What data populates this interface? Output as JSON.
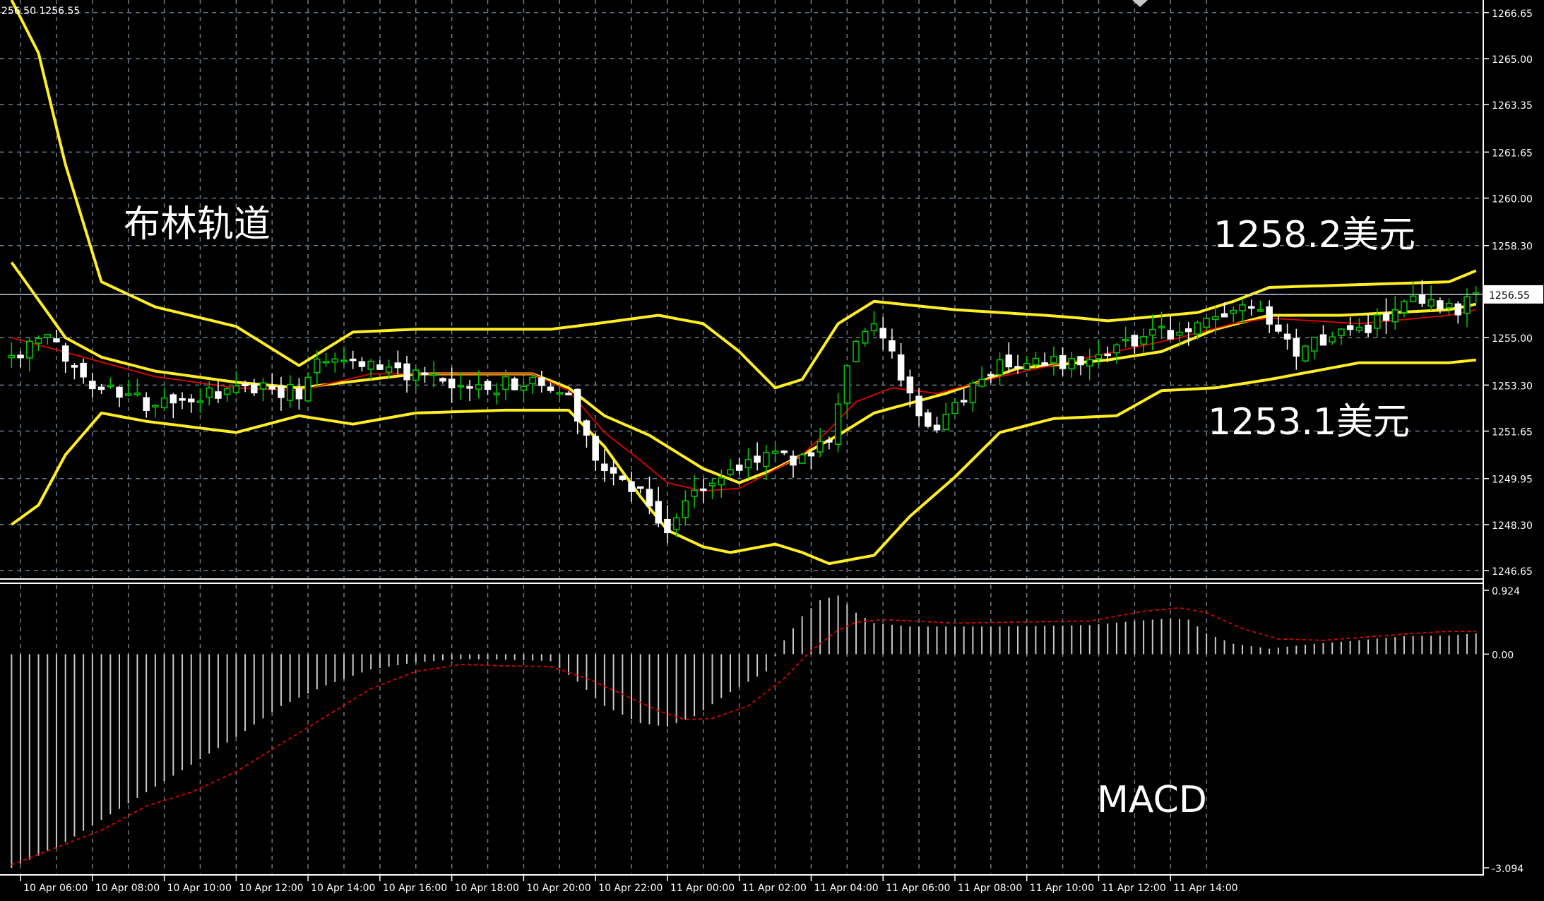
{
  "header": {
    "text": "256.50 1256.55"
  },
  "annotations": {
    "bollinger": "布林轨道",
    "upper_price": "1258.2美元",
    "lower_price": "1253.1美元",
    "macd": "MACD"
  },
  "colors": {
    "background": "#000000",
    "grid": "#6b7b8c",
    "bull_candle": "#00cc00",
    "bear_candle": "#ffffff",
    "bollinger": "#ffee22",
    "moving_average": "#e00000",
    "macd_histogram": "#c8c8c8",
    "signal_line": "#e00000",
    "axis_text": "#ffffff"
  },
  "chart_data": [
    {
      "type": "candlestick",
      "title": "",
      "x_tick_labels": [
        "10 Apr 06:00",
        "10 Apr 08:00",
        "10 Apr 10:00",
        "10 Apr 12:00",
        "10 Apr 14:00",
        "10 Apr 16:00",
        "10 Apr 18:00",
        "10 Apr 20:00",
        "10 Apr 22:00",
        "11 Apr 00:00",
        "11 Apr 02:00",
        "11 Apr 04:00",
        "11 Apr 06:00",
        "11 Apr 08:00",
        "11 Apr 10:00",
        "11 Apr 12:00",
        "11 Apr 14:00"
      ],
      "y_tick_labels": [
        "1266.65",
        "1265.00",
        "1263.35",
        "1261.65",
        "1260.00",
        "1258.30",
        "1256.55",
        "1255.00",
        "1253.30",
        "1251.65",
        "1249.95",
        "1248.30",
        "1246.65"
      ],
      "ylim": [
        1246.4,
        1267.1
      ],
      "current_price": 1256.55,
      "current_price_label": "1256.55",
      "close_anchors": [
        [
          0,
          1254.3
        ],
        [
          4,
          1255.0
        ],
        [
          8,
          1253.6
        ],
        [
          12,
          1253.0
        ],
        [
          16,
          1252.5
        ],
        [
          20,
          1252.8
        ],
        [
          24,
          1253.0
        ],
        [
          28,
          1253.3
        ],
        [
          32,
          1253.0
        ],
        [
          34,
          1254.4
        ],
        [
          38,
          1254.2
        ],
        [
          42,
          1253.9
        ],
        [
          46,
          1253.5
        ],
        [
          50,
          1253.1
        ],
        [
          54,
          1253.3
        ],
        [
          58,
          1253.4
        ],
        [
          62,
          1252.9
        ],
        [
          66,
          1250.2
        ],
        [
          70,
          1249.6
        ],
        [
          73,
          1248.0
        ],
        [
          76,
          1249.5
        ],
        [
          80,
          1250.2
        ],
        [
          84,
          1250.9
        ],
        [
          88,
          1250.6
        ],
        [
          91,
          1251.5
        ],
        [
          93,
          1254.0
        ],
        [
          95,
          1255.5
        ],
        [
          98,
          1254.6
        ],
        [
          100,
          1252.8
        ],
        [
          103,
          1251.6
        ],
        [
          106,
          1252.8
        ],
        [
          110,
          1254.2
        ],
        [
          115,
          1254.0
        ],
        [
          120,
          1254.4
        ],
        [
          125,
          1255.0
        ],
        [
          130,
          1255.2
        ],
        [
          135,
          1255.8
        ],
        [
          138,
          1256.0
        ],
        [
          140,
          1255.4
        ],
        [
          143,
          1254.3
        ],
        [
          146,
          1255.0
        ],
        [
          151,
          1255.4
        ],
        [
          156,
          1256.2
        ],
        [
          161,
          1255.9
        ],
        [
          163,
          1256.55
        ]
      ],
      "bollinger": {
        "period": 20,
        "upper_anchors": [
          [
            0,
            1267.1
          ],
          [
            3,
            1265.2
          ],
          [
            6,
            1261.2
          ],
          [
            10,
            1257.0
          ],
          [
            16,
            1256.1
          ],
          [
            25,
            1255.4
          ],
          [
            32,
            1254.0
          ],
          [
            38,
            1255.2
          ],
          [
            45,
            1255.3
          ],
          [
            60,
            1255.3
          ],
          [
            65,
            1255.5
          ],
          [
            72,
            1255.8
          ],
          [
            77,
            1255.5
          ],
          [
            81,
            1254.5
          ],
          [
            85,
            1253.2
          ],
          [
            88,
            1253.5
          ],
          [
            92,
            1255.5
          ],
          [
            96,
            1256.3
          ],
          [
            105,
            1256.0
          ],
          [
            115,
            1255.8
          ],
          [
            119,
            1255.7
          ],
          [
            122,
            1255.6
          ],
          [
            132,
            1255.9
          ],
          [
            136,
            1256.3
          ],
          [
            140,
            1256.8
          ],
          [
            160,
            1257.0
          ],
          [
            163,
            1257.4
          ]
        ],
        "middle_anchors": [
          [
            0,
            1257.7
          ],
          [
            6,
            1255.0
          ],
          [
            10,
            1254.3
          ],
          [
            16,
            1253.8
          ],
          [
            25,
            1253.4
          ],
          [
            32,
            1253.2
          ],
          [
            45,
            1253.7
          ],
          [
            58,
            1253.7
          ],
          [
            62,
            1253.2
          ],
          [
            66,
            1252.2
          ],
          [
            71,
            1251.5
          ],
          [
            77,
            1250.3
          ],
          [
            81,
            1249.8
          ],
          [
            85,
            1250.3
          ],
          [
            88,
            1250.8
          ],
          [
            92,
            1251.5
          ],
          [
            96,
            1252.3
          ],
          [
            104,
            1253.0
          ],
          [
            112,
            1253.9
          ],
          [
            122,
            1254.2
          ],
          [
            128,
            1254.5
          ],
          [
            134,
            1255.3
          ],
          [
            140,
            1255.8
          ],
          [
            148,
            1255.8
          ],
          [
            160,
            1256.0
          ],
          [
            163,
            1256.2
          ]
        ],
        "lower_anchors": [
          [
            0,
            1248.3
          ],
          [
            3,
            1249.0
          ],
          [
            6,
            1250.8
          ],
          [
            10,
            1252.3
          ],
          [
            15,
            1252.0
          ],
          [
            25,
            1251.6
          ],
          [
            32,
            1252.2
          ],
          [
            38,
            1251.9
          ],
          [
            45,
            1252.3
          ],
          [
            55,
            1252.4
          ],
          [
            62,
            1252.4
          ],
          [
            66,
            1251.1
          ],
          [
            70,
            1249.3
          ],
          [
            73,
            1248.1
          ],
          [
            77,
            1247.5
          ],
          [
            80,
            1247.3
          ],
          [
            85,
            1247.6
          ],
          [
            88,
            1247.3
          ],
          [
            91,
            1246.9
          ],
          [
            96,
            1247.2
          ],
          [
            100,
            1248.6
          ],
          [
            105,
            1250.0
          ],
          [
            110,
            1251.6
          ],
          [
            116,
            1252.1
          ],
          [
            123,
            1252.2
          ],
          [
            128,
            1253.1
          ],
          [
            134,
            1253.2
          ],
          [
            140,
            1253.5
          ],
          [
            150,
            1254.1
          ],
          [
            160,
            1254.1
          ],
          [
            163,
            1254.2
          ]
        ]
      },
      "moving_average_anchors": [
        [
          0,
          1255.0
        ],
        [
          8,
          1254.3
        ],
        [
          16,
          1253.6
        ],
        [
          25,
          1253.2
        ],
        [
          32,
          1253.1
        ],
        [
          40,
          1253.7
        ],
        [
          58,
          1253.7
        ],
        [
          62,
          1253.1
        ],
        [
          66,
          1251.6
        ],
        [
          70,
          1250.6
        ],
        [
          73,
          1249.8
        ],
        [
          77,
          1249.5
        ],
        [
          81,
          1249.6
        ],
        [
          84,
          1250.1
        ],
        [
          88,
          1250.8
        ],
        [
          91,
          1251.7
        ],
        [
          94,
          1252.7
        ],
        [
          98,
          1253.2
        ],
        [
          103,
          1253.0
        ],
        [
          110,
          1253.6
        ],
        [
          120,
          1254.3
        ],
        [
          130,
          1255.0
        ],
        [
          136,
          1255.5
        ],
        [
          140,
          1255.7
        ],
        [
          150,
          1255.5
        ],
        [
          160,
          1255.8
        ],
        [
          163,
          1256.0
        ]
      ]
    },
    {
      "type": "bar",
      "title": "MACD",
      "y_tick_labels": [
        "0.924",
        "0.00",
        "-3.094"
      ],
      "ylim": [
        -3.094,
        0.924
      ],
      "histogram_anchors": [
        [
          0,
          -3.094
        ],
        [
          5,
          -2.8
        ],
        [
          10,
          -2.4
        ],
        [
          15,
          -2.0
        ],
        [
          20,
          -1.6
        ],
        [
          25,
          -1.2
        ],
        [
          30,
          -0.75
        ],
        [
          35,
          -0.45
        ],
        [
          40,
          -0.22
        ],
        [
          45,
          -0.12
        ],
        [
          50,
          -0.07
        ],
        [
          55,
          -0.08
        ],
        [
          60,
          -0.1
        ],
        [
          63,
          -0.4
        ],
        [
          66,
          -0.75
        ],
        [
          70,
          -1.0
        ],
        [
          73,
          -1.05
        ],
        [
          76,
          -0.9
        ],
        [
          80,
          -0.55
        ],
        [
          84,
          -0.25
        ],
        [
          86,
          0.2
        ],
        [
          88,
          0.55
        ],
        [
          90,
          0.78
        ],
        [
          92,
          0.85
        ],
        [
          94,
          0.6
        ],
        [
          96,
          0.45
        ],
        [
          100,
          0.4
        ],
        [
          110,
          0.4
        ],
        [
          120,
          0.42
        ],
        [
          125,
          0.48
        ],
        [
          129,
          0.52
        ],
        [
          131,
          0.5
        ],
        [
          133,
          0.3
        ],
        [
          136,
          0.15
        ],
        [
          140,
          0.08
        ],
        [
          145,
          0.15
        ],
        [
          150,
          0.2
        ],
        [
          155,
          0.26
        ],
        [
          160,
          0.27
        ],
        [
          163,
          0.3
        ]
      ],
      "signal_anchors": [
        [
          0,
          -3.05
        ],
        [
          10,
          -2.55
        ],
        [
          15,
          -2.2
        ],
        [
          20,
          -2.0
        ],
        [
          25,
          -1.7
        ],
        [
          30,
          -1.3
        ],
        [
          35,
          -0.9
        ],
        [
          40,
          -0.5
        ],
        [
          45,
          -0.25
        ],
        [
          50,
          -0.15
        ],
        [
          55,
          -0.17
        ],
        [
          60,
          -0.18
        ],
        [
          64,
          -0.35
        ],
        [
          68,
          -0.58
        ],
        [
          72,
          -0.82
        ],
        [
          75,
          -0.95
        ],
        [
          78,
          -0.93
        ],
        [
          82,
          -0.75
        ],
        [
          86,
          -0.35
        ],
        [
          89,
          0.05
        ],
        [
          92,
          0.35
        ],
        [
          94,
          0.46
        ],
        [
          97,
          0.5
        ],
        [
          105,
          0.45
        ],
        [
          115,
          0.47
        ],
        [
          120,
          0.48
        ],
        [
          126,
          0.62
        ],
        [
          130,
          0.67
        ],
        [
          133,
          0.6
        ],
        [
          137,
          0.37
        ],
        [
          141,
          0.22
        ],
        [
          146,
          0.2
        ],
        [
          150,
          0.24
        ],
        [
          156,
          0.3
        ],
        [
          160,
          0.33
        ],
        [
          163,
          0.33
        ]
      ]
    }
  ]
}
